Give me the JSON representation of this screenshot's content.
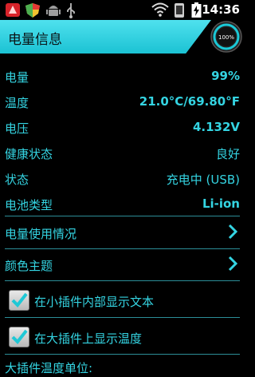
{
  "status_bar": {
    "time": "14:36",
    "icons": [
      "app-icon-red",
      "shield-icon",
      "android-icon",
      "usb-icon",
      "wifi-icon",
      "phone-icon",
      "battery-charging-icon"
    ]
  },
  "header": {
    "title": "电量信息",
    "gauge_text": "100%",
    "gauge_level": 1.0
  },
  "info": {
    "battery_label": "电量",
    "battery_value": "99%",
    "temp_label": "温度",
    "temp_value": "21.0°C/69.80°F",
    "voltage_label": "电压",
    "voltage_value": "4.132V",
    "health_label": "健康状态",
    "health_value": "良好",
    "status_label": "状态",
    "status_value": "充电中 (USB)",
    "type_label": "电池类型",
    "type_value": "Li-ion"
  },
  "nav": {
    "usage_label": "电量使用情况",
    "theme_label": "颜色主题"
  },
  "options": {
    "small_widget_text": "在小插件内部显示文本",
    "small_widget_checked": true,
    "large_widget_temp": "在大插件上显示温度",
    "large_widget_checked": true,
    "unit_label": "大插件温度单位:"
  },
  "colors": {
    "accent": "#34d4e2",
    "background": "#000000"
  }
}
